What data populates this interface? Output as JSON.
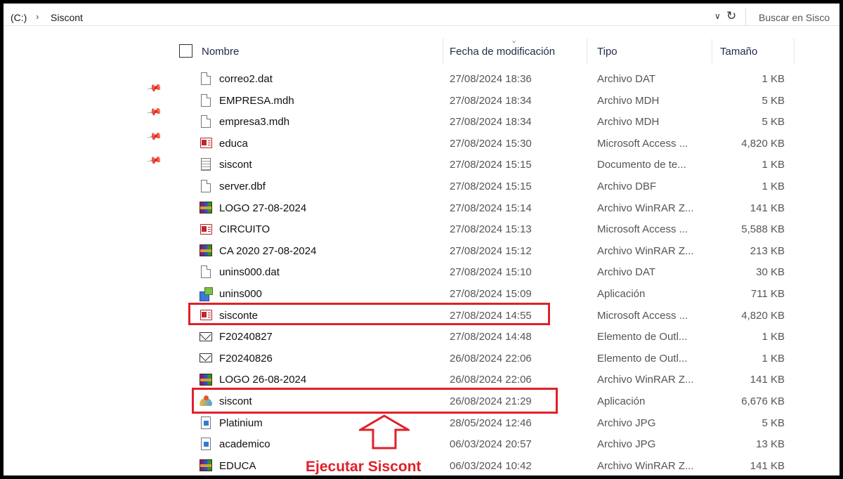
{
  "address_bar": {
    "drive": "(C:)",
    "separator": "›",
    "folder": "Siscont",
    "search_placeholder": "Buscar en Sisco"
  },
  "columns": {
    "name": "Nombre",
    "date": "Fecha de modificación",
    "type": "Tipo",
    "size": "Tamaño"
  },
  "files": [
    {
      "name": "correo2.dat",
      "date": "27/08/2024 18:36",
      "type": "Archivo DAT",
      "size": "1 KB",
      "icon": "file-icon"
    },
    {
      "name": "EMPRESA.mdh",
      "date": "27/08/2024 18:34",
      "type": "Archivo MDH",
      "size": "5 KB",
      "icon": "file-icon"
    },
    {
      "name": "empresa3.mdh",
      "date": "27/08/2024 18:34",
      "type": "Archivo MDH",
      "size": "5 KB",
      "icon": "file-icon"
    },
    {
      "name": "educa",
      "date": "27/08/2024 15:30",
      "type": "Microsoft Access ...",
      "size": "4,820 KB",
      "icon": "access-icon"
    },
    {
      "name": "siscont",
      "date": "27/08/2024 15:15",
      "type": "Documento de te...",
      "size": "1 KB",
      "icon": "text-document-icon"
    },
    {
      "name": "server.dbf",
      "date": "27/08/2024 15:15",
      "type": "Archivo DBF",
      "size": "1 KB",
      "icon": "file-icon"
    },
    {
      "name": "LOGO 27-08-2024",
      "date": "27/08/2024 15:14",
      "type": "Archivo WinRAR Z...",
      "size": "141 KB",
      "icon": "winrar-icon"
    },
    {
      "name": "CIRCUITO",
      "date": "27/08/2024 15:13",
      "type": "Microsoft Access ...",
      "size": "5,588 KB",
      "icon": "access-icon"
    },
    {
      "name": "CA 2020 27-08-2024",
      "date": "27/08/2024 15:12",
      "type": "Archivo WinRAR Z...",
      "size": "213 KB",
      "icon": "winrar-icon"
    },
    {
      "name": "unins000.dat",
      "date": "27/08/2024 15:10",
      "type": "Archivo DAT",
      "size": "30 KB",
      "icon": "file-icon"
    },
    {
      "name": "unins000",
      "date": "27/08/2024 15:09",
      "type": "Aplicación",
      "size": "711 KB",
      "icon": "application-icon"
    },
    {
      "name": "sisconte",
      "date": "27/08/2024 14:55",
      "type": "Microsoft Access ...",
      "size": "4,820 KB",
      "icon": "access-icon"
    },
    {
      "name": "F20240827",
      "date": "27/08/2024 14:48",
      "type": "Elemento de Outl...",
      "size": "1 KB",
      "icon": "mail-icon"
    },
    {
      "name": "F20240826",
      "date": "26/08/2024 22:06",
      "type": "Elemento de Outl...",
      "size": "1 KB",
      "icon": "mail-icon"
    },
    {
      "name": "LOGO 26-08-2024",
      "date": "26/08/2024 22:06",
      "type": "Archivo WinRAR Z...",
      "size": "141 KB",
      "icon": "winrar-icon"
    },
    {
      "name": "siscont",
      "date": "26/08/2024 21:29",
      "type": "Aplicación",
      "size": "6,676 KB",
      "icon": "siscont-app-icon"
    },
    {
      "name": "Platinium",
      "date": "28/05/2024 12:46",
      "type": "Archivo JPG",
      "size": "5 KB",
      "icon": "jpg-icon"
    },
    {
      "name": "academico",
      "date": "06/03/2024 20:57",
      "type": "Archivo JPG",
      "size": "13 KB",
      "icon": "jpg-icon"
    },
    {
      "name": "EDUCA",
      "date": "06/03/2024 10:42",
      "type": "Archivo WinRAR Z...",
      "size": "141 KB",
      "icon": "winrar-icon"
    }
  ],
  "annotation": {
    "label": "Ejecutar Siscont",
    "color": "#e0202a"
  }
}
